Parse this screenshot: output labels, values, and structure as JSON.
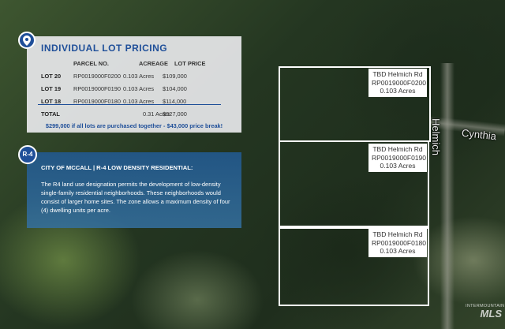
{
  "pricing": {
    "title": "INDIVIDUAL LOT PRICING",
    "headers": {
      "parcel": "PARCEL NO.",
      "acreage": "ACREAGE",
      "price": "LOT PRICE"
    },
    "rows": [
      {
        "lot": "LOT 20",
        "parcel": "RP0019000F0200",
        "acreage": "0.103 Acres",
        "price": "$109,000"
      },
      {
        "lot": "LOT 19",
        "parcel": "RP0019000F0190",
        "acreage": "0.103 Acres",
        "price": "$104,000"
      },
      {
        "lot": "LOT 18",
        "parcel": "RP0019000F0180",
        "acreage": "0.103 Acres",
        "price": "$114,000"
      }
    ],
    "total": {
      "label": "TOTAL",
      "acreage": "0.31 Acres",
      "price": "$327,000"
    },
    "promo": "$299,000 if all lots are purchased together - $43,000 price break!"
  },
  "zoning": {
    "badge": "R-4",
    "heading": "CITY OF MCCALL | R-4 LOW DENSITY RESIDENTIAL:",
    "body": "The R4 land use designation permits the development of low-density single-family residential neighborhoods. These neighborhoods would consist of larger home sites. The zone allows a maximum density of four (4) dwelling units per acre."
  },
  "map_labels": [
    {
      "line1": "TBD Helmich Rd",
      "line2": "RP0019000F0200",
      "line3": "0.103 Acres"
    },
    {
      "line1": "TBD Helmich Rd",
      "line2": "RP0019000F0190",
      "line3": "0.103 Acres"
    },
    {
      "line1": "TBD Helmich Rd",
      "line2": "RP0019000F0180",
      "line3": "0.103 Acres"
    }
  ],
  "roads": {
    "vertical": "Helmich",
    "horizontal": "Cynthia"
  },
  "watermark": {
    "top": "INTERMOUNTAIN",
    "bottom": "MLS"
  },
  "colors": {
    "accent": "#1f4f99",
    "panel": "#ececf0",
    "zoning_panel": "#22588c",
    "outline": "#ffffff"
  },
  "icons": {
    "pin": "location-pin-icon"
  }
}
